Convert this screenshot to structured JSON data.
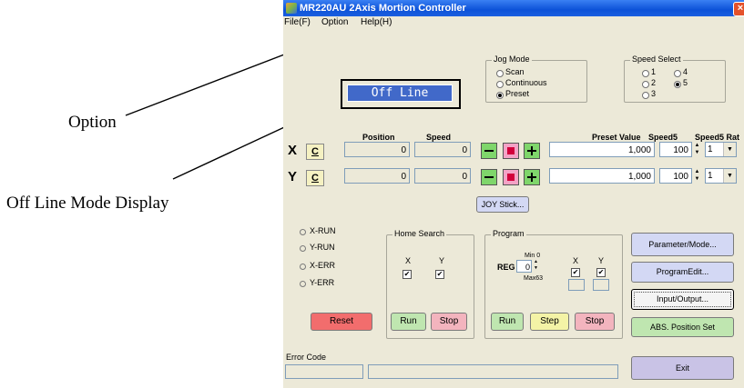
{
  "annotations": {
    "option": "Option",
    "offline_mode": "Off Line Mode Display"
  },
  "window": {
    "title": "MR220AU 2Axis Mortion Controller",
    "close_glyph": "×",
    "menu": [
      "File(F)",
      "Option",
      "Help(H)"
    ]
  },
  "display": {
    "status": "Off Line"
  },
  "jog_mode": {
    "title": "Jog Mode",
    "options": [
      "Scan",
      "Continuous",
      "Preset"
    ],
    "selected": "Preset"
  },
  "speed_select": {
    "title": "Speed Select",
    "options": [
      "1",
      "2",
      "3",
      "4",
      "5"
    ],
    "selected": "5"
  },
  "axis_headers": {
    "position": "Position",
    "speed": "Speed",
    "preset_value": "Preset Value",
    "speed5": "Speed5",
    "speed5_rate": "Speed5 Rat"
  },
  "axes": [
    {
      "name": "X",
      "clear": "C",
      "position": "0",
      "speed": "0",
      "preset": "1,000",
      "speed5": "100",
      "rate": "1"
    },
    {
      "name": "Y",
      "clear": "C",
      "position": "0",
      "speed": "0",
      "preset": "1,000",
      "speed5": "100",
      "rate": "1"
    }
  ],
  "joystick_label": "JOY Stick...",
  "status_leds": [
    "X-RUN",
    "Y-RUN",
    "X-ERR",
    "Y-ERR"
  ],
  "home_search": {
    "title": "Home Search",
    "x": "X",
    "y": "Y",
    "check_glyph": "✔",
    "run": "Run",
    "stop": "Stop"
  },
  "program": {
    "title": "Program",
    "reg_label": "REG",
    "reg_value": "0",
    "min_label": "Min 0",
    "max_label": "Max63",
    "x": "X",
    "y": "Y",
    "run": "Run",
    "step": "Step",
    "stop": "Stop"
  },
  "reset_label": "Reset",
  "right_buttons": {
    "parameter": "Parameter/Mode...",
    "program_edit": "ProgramEdit...",
    "io": "Input/Output...",
    "abs": "ABS. Position Set",
    "exit": "Exit"
  },
  "error_code": {
    "label": "Error Code",
    "code": "",
    "message": ""
  }
}
